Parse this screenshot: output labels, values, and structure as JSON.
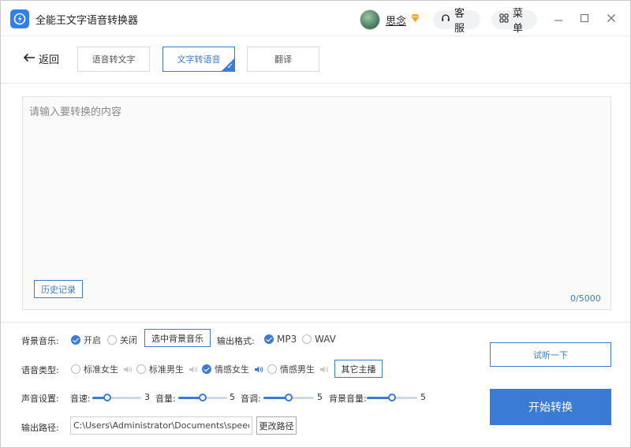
{
  "app": {
    "title": "全能王文字语音转换器"
  },
  "header": {
    "user_name": "思念",
    "service_label": "客服",
    "menu_label": "菜单",
    "minimize_icon": "minimize-icon",
    "maximize_icon": "maximize-icon",
    "close_icon": "close-icon"
  },
  "nav": {
    "back_label": "返回",
    "tabs": [
      {
        "label": "语音转文字",
        "active": false
      },
      {
        "label": "文字转语音",
        "active": true
      },
      {
        "label": "翻译",
        "active": false
      }
    ]
  },
  "editor": {
    "placeholder": "请输入要转换的内容",
    "value": "",
    "char_count": "0/5000",
    "history_label": "历史记录"
  },
  "bg_music": {
    "label": "背景音乐:",
    "on_label": "开启",
    "off_label": "关闭",
    "selected": "on",
    "choose_label": "选中背景音乐"
  },
  "output_format": {
    "label": "输出格式:",
    "options": [
      "MP3",
      "WAV"
    ],
    "selected": "MP3"
  },
  "voice_type": {
    "label": "语音类型:",
    "options": [
      "标准女生",
      "标准男生",
      "情感女生",
      "情感男生"
    ],
    "selected": "情感女生",
    "other_label": "其它主播"
  },
  "sound": {
    "label": "声音设置:",
    "speed": {
      "label": "音速:",
      "value": 3,
      "max": 10
    },
    "volume": {
      "label": "音量:",
      "value": 5,
      "max": 10
    },
    "pitch": {
      "label": "音调:",
      "value": 5,
      "max": 10
    },
    "bg_volume": {
      "label": "背景音量:",
      "value": 5,
      "max": 10
    }
  },
  "output_path": {
    "label": "输出路径:",
    "value": "C:\\Users\\Administrator\\Documents\\speechconverter",
    "change_label": "更改路径"
  },
  "actions": {
    "try_label": "试听一下",
    "start_label": "开始转换"
  },
  "colors": {
    "accent": "#3a7bd5"
  }
}
